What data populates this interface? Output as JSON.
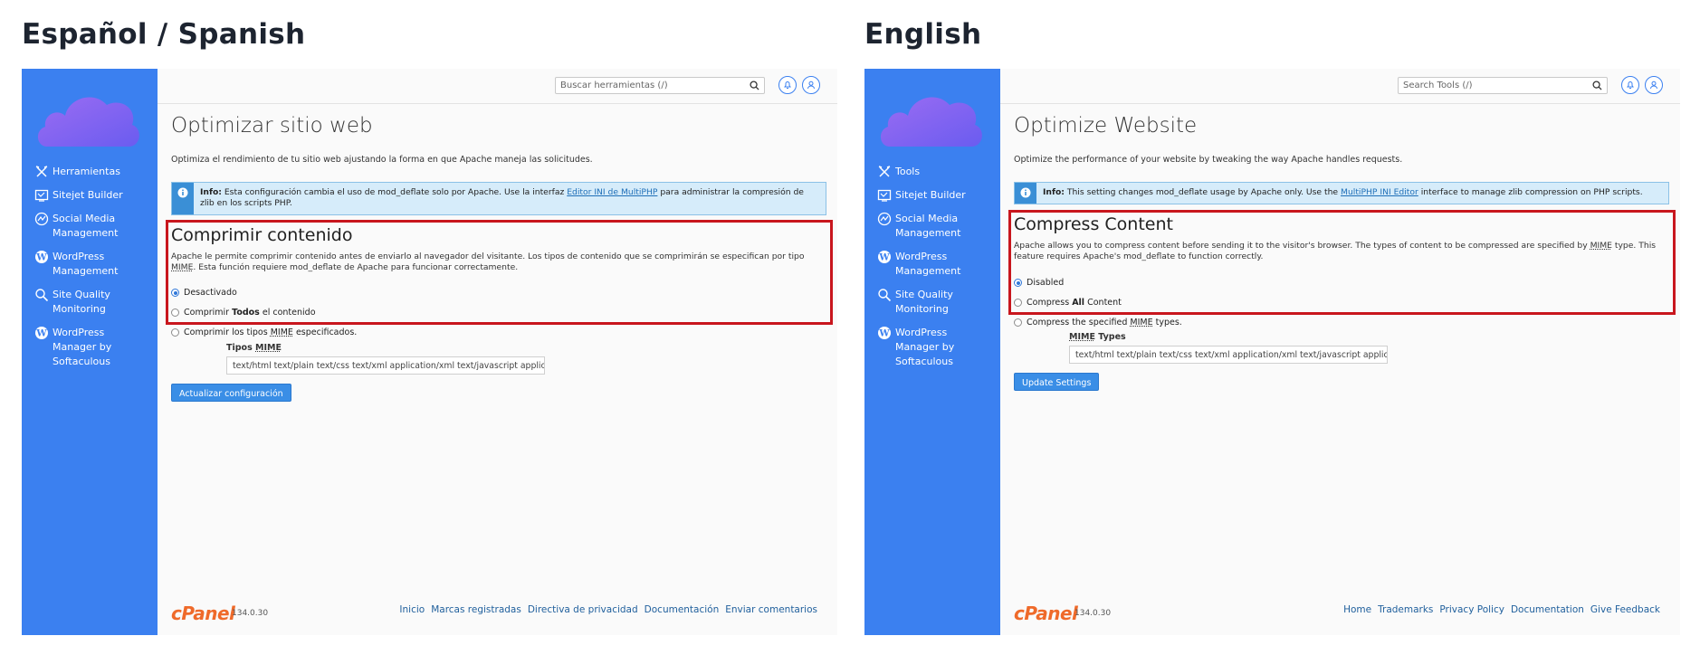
{
  "headings": {
    "left": "Español / Spanish",
    "right": "English"
  },
  "colors": {
    "sidebar": "#3b80f0",
    "accent": "#3a8ee6",
    "highlight": "#c8161d",
    "info_bg": "#d6ecfa",
    "cpanel_orange": "#ef6a2a"
  },
  "spanish": {
    "search_placeholder": "Buscar herramientas (/)",
    "nav": [
      {
        "label": "Herramientas",
        "icon": "tools-icon"
      },
      {
        "label": "Sitejet Builder",
        "icon": "sitejet-icon"
      },
      {
        "label": "Social Media\nManagement",
        "icon": "social-media-icon"
      },
      {
        "label": "WordPress\nManagement",
        "icon": "wordpress-icon"
      },
      {
        "label": "Site Quality\nMonitoring",
        "icon": "site-quality-icon"
      },
      {
        "label": "WordPress\nManager by\nSoftaculous",
        "icon": "wordpress-icon"
      }
    ],
    "title": "Optimizar sitio web",
    "intro": "Optimiza el rendimiento de tu sitio web ajustando la forma en que Apache maneja las solicitudes.",
    "info_label": "Info:",
    "info_pre": "Esta configuración cambia el uso de mod_deflate solo por Apache. Use la interfaz",
    "info_link": "Editor INI de MultiPHP",
    "info_post": "para administrar la compresión de zlib en los scripts PHP.",
    "section_title": "Comprimir contenido",
    "section_desc_a": "Apache le permite comprimir contenido antes de enviarlo al navegador del visitante. Los tipos de contenido que se comprimirán se especifican por tipo",
    "section_desc_mime": "MIME",
    "section_desc_b": ". Esta función requiere mod_deflate de Apache para funcionar correctamente.",
    "radio_disabled": "Desactivado",
    "radio_all_pre": "Comprimir",
    "radio_all_bold": "Todos",
    "radio_all_post": "el contenido",
    "radio_spec_pre": "Comprimir los tipos",
    "radio_spec_mime": "MIME",
    "radio_spec_post": "especificados.",
    "mime_label_pre": "Tipos",
    "mime_label_mime": "MIME",
    "mime_value": "text/html text/plain text/css text/xml application/xml text/javascript application/jav",
    "update_button": "Actualizar configuración",
    "version": "134.0.30",
    "footer": [
      "Inicio",
      "Marcas registradas",
      "Directiva de privacidad",
      "Documentación",
      "Enviar comentarios"
    ]
  },
  "english": {
    "search_placeholder": "Search Tools (/)",
    "nav": [
      {
        "label": "Tools",
        "icon": "tools-icon"
      },
      {
        "label": "Sitejet Builder",
        "icon": "sitejet-icon"
      },
      {
        "label": "Social Media\nManagement",
        "icon": "social-media-icon"
      },
      {
        "label": "WordPress\nManagement",
        "icon": "wordpress-icon"
      },
      {
        "label": "Site Quality\nMonitoring",
        "icon": "site-quality-icon"
      },
      {
        "label": "WordPress\nManager by\nSoftaculous",
        "icon": "wordpress-icon"
      }
    ],
    "title": "Optimize Website",
    "intro": "Optimize the performance of your website by tweaking the way Apache handles requests.",
    "info_label": "Info:",
    "info_pre": "This setting changes mod_deflate usage by Apache only. Use the",
    "info_link": "MultiPHP INI Editor",
    "info_post": "interface to manage zlib compression on PHP scripts.",
    "section_title": "Compress Content",
    "section_desc_a": "Apache allows you to compress content before sending it to the visitor's browser. The types of content to be compressed are specified by",
    "section_desc_mime": "MIME",
    "section_desc_b": "type. This feature requires Apache's mod_deflate to function correctly.",
    "radio_disabled": "Disabled",
    "radio_all_pre": "Compress",
    "radio_all_bold": "All",
    "radio_all_post": "Content",
    "radio_spec_pre": "Compress the specified",
    "radio_spec_mime": "MIME",
    "radio_spec_post": "types.",
    "mime_label_pre": "",
    "mime_label_mime": "MIME",
    "mime_label_post": "Types",
    "mime_value": "text/html text/plain text/css text/xml application/xml text/javascript application/jav",
    "update_button": "Update Settings",
    "version": "134.0.30",
    "footer": [
      "Home",
      "Trademarks",
      "Privacy Policy",
      "Documentation",
      "Give Feedback"
    ]
  }
}
